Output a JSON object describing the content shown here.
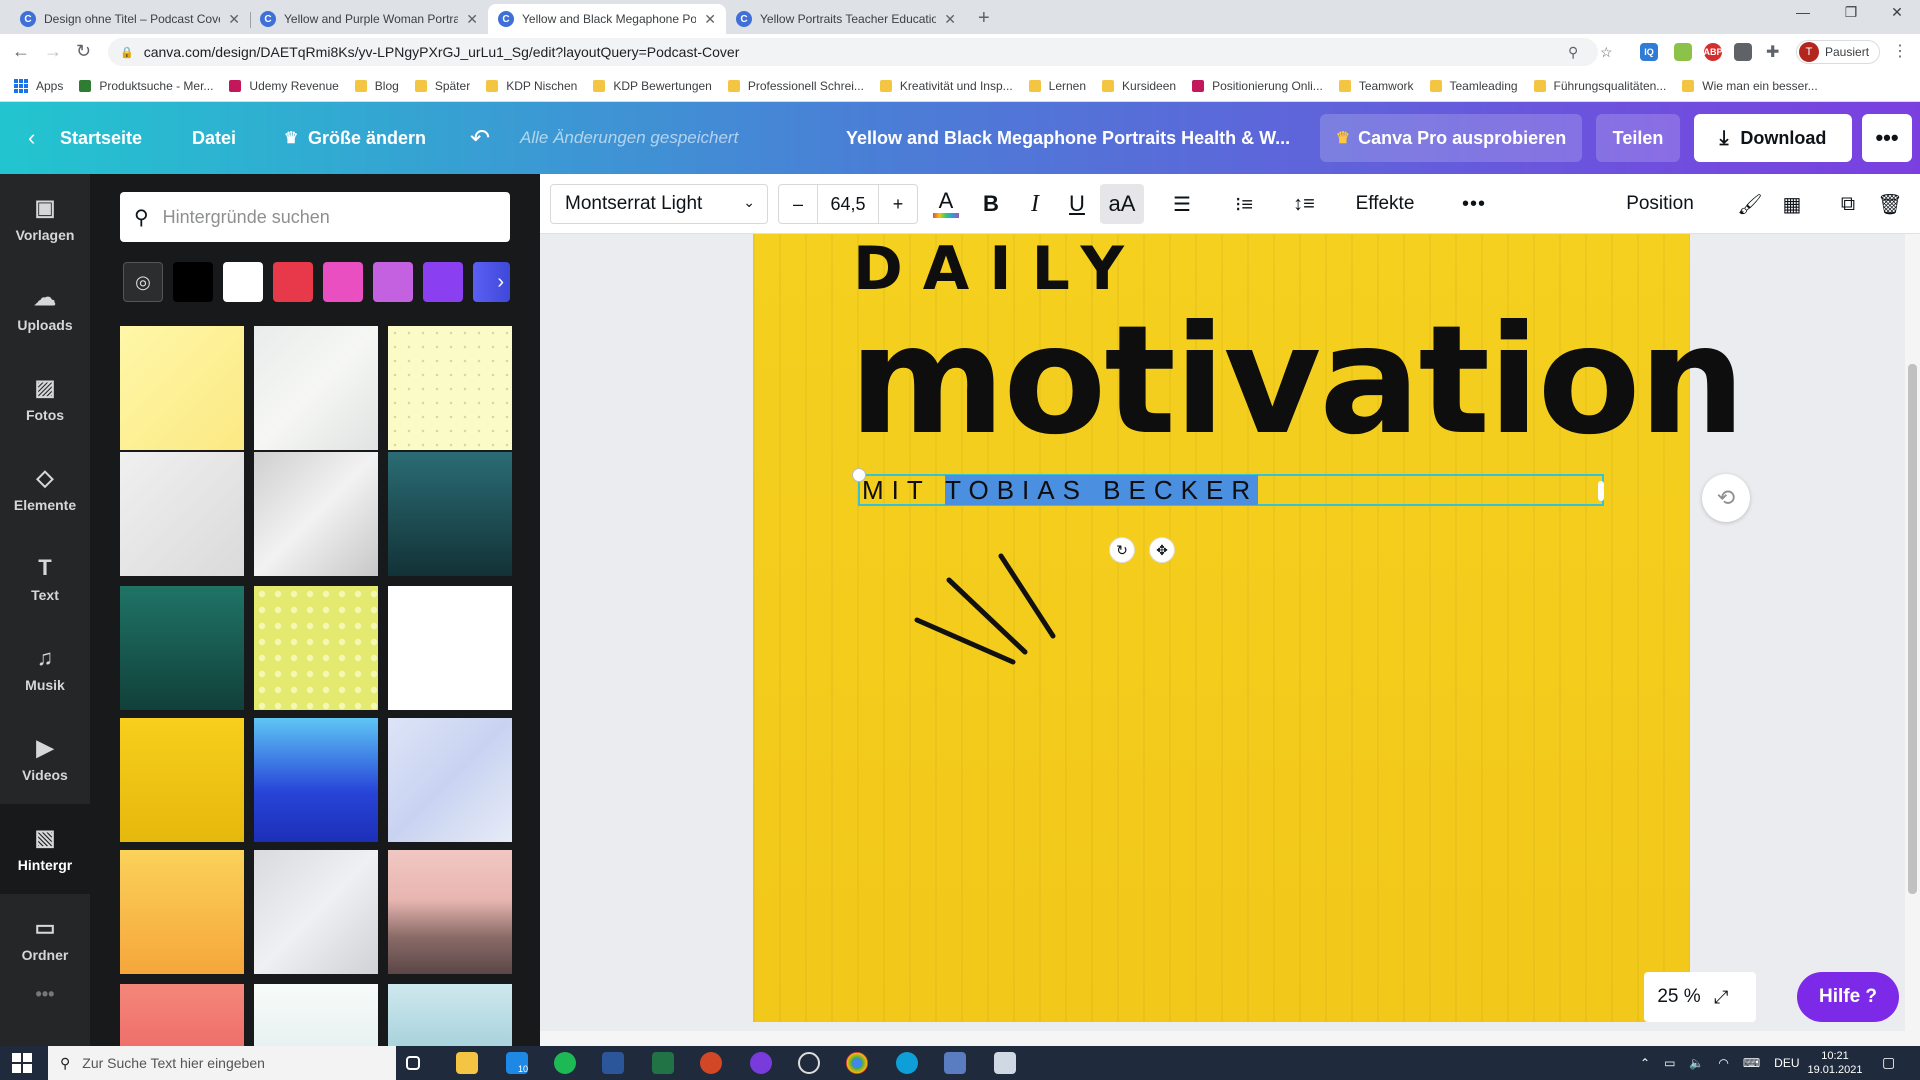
{
  "browser": {
    "tabs": [
      {
        "title": "Design ohne Titel – Podcast Cover",
        "active": false
      },
      {
        "title": "Yellow and Purple Woman Portrait",
        "active": false
      },
      {
        "title": "Yellow and Black Megaphone Portr",
        "active": true
      },
      {
        "title": "Yellow Portraits Teacher Education",
        "active": false
      }
    ],
    "url": "canva.com/design/DAETqRmi8Ks/yv-LPNgyPXrGJ_urLu1_Sg/edit?layoutQuery=Podcast-Cover",
    "profile_initial": "T",
    "profile_label": "Pausiert",
    "extension_labels": {
      "iq": "IQ",
      "abp": "ABP"
    },
    "bookmarks": [
      "Apps",
      "Produktsuche - Mer...",
      "Udemy Revenue",
      "Blog",
      "Später",
      "KDP Nischen",
      "KDP Bewertungen",
      "Professionell Schrei...",
      "Kreativität und Insp...",
      "Lernen",
      "Kursideen",
      "Positionierung Onli...",
      "Teamwork",
      "Teamleading",
      "Führungsqualitäten...",
      "Wie man ein besser..."
    ]
  },
  "header": {
    "home": "Startseite",
    "file": "Datei",
    "resize": "Größe ändern",
    "saved_status": "Alle Änderungen gespeichert",
    "design_title": "Yellow and Black Megaphone Portraits Health & W...",
    "pro_button": "Canva Pro ausprobieren",
    "share_button": "Teilen",
    "download_button": "Download"
  },
  "rail": [
    {
      "label": "Vorlagen",
      "icon": "templates-icon"
    },
    {
      "label": "Uploads",
      "icon": "upload-cloud-icon"
    },
    {
      "label": "Fotos",
      "icon": "photo-icon"
    },
    {
      "label": "Elemente",
      "icon": "elements-icon"
    },
    {
      "label": "Text",
      "icon": "text-icon"
    },
    {
      "label": "Musik",
      "icon": "music-icon"
    },
    {
      "label": "Videos",
      "icon": "video-icon"
    },
    {
      "label": "Hintergr",
      "icon": "background-icon",
      "active": true
    },
    {
      "label": "Ordner",
      "icon": "folder-icon"
    }
  ],
  "panel": {
    "search_placeholder": "Hintergründe suchen",
    "swatches": [
      "#000000",
      "#ffffff",
      "#e8394a",
      "#e94fc0",
      "#c361e0",
      "#8a3ff0",
      "#5b5ff5"
    ]
  },
  "toolbar": {
    "font": "Montserrat Light",
    "size": "64,5",
    "minus": "–",
    "plus": "+",
    "text_color_glyph": "A",
    "bold": "B",
    "italic": "I",
    "underline": "U",
    "case": "aA",
    "effects": "Effekte",
    "more": "•••",
    "position": "Position"
  },
  "canvas": {
    "line1": "DAILY",
    "line2": "motivation",
    "subtitle_unselected": "MIT ",
    "subtitle_selected": "TOBIAS BECKER",
    "zoom": "25 %",
    "help": "Hilfe ?"
  },
  "taskbar": {
    "search_placeholder": "Zur Suche Text hier eingeben",
    "language": "DEU",
    "time": "10:21",
    "date": "19.01.2021",
    "mail_badge": "10"
  },
  "colors": {
    "canva_gradient_start": "#22c5cf",
    "canva_gradient_end": "#7b3fe0",
    "design_yellow": "#f3cb1d",
    "selection_blue": "#4a8fe0",
    "help_purple": "#7d2ae8"
  }
}
